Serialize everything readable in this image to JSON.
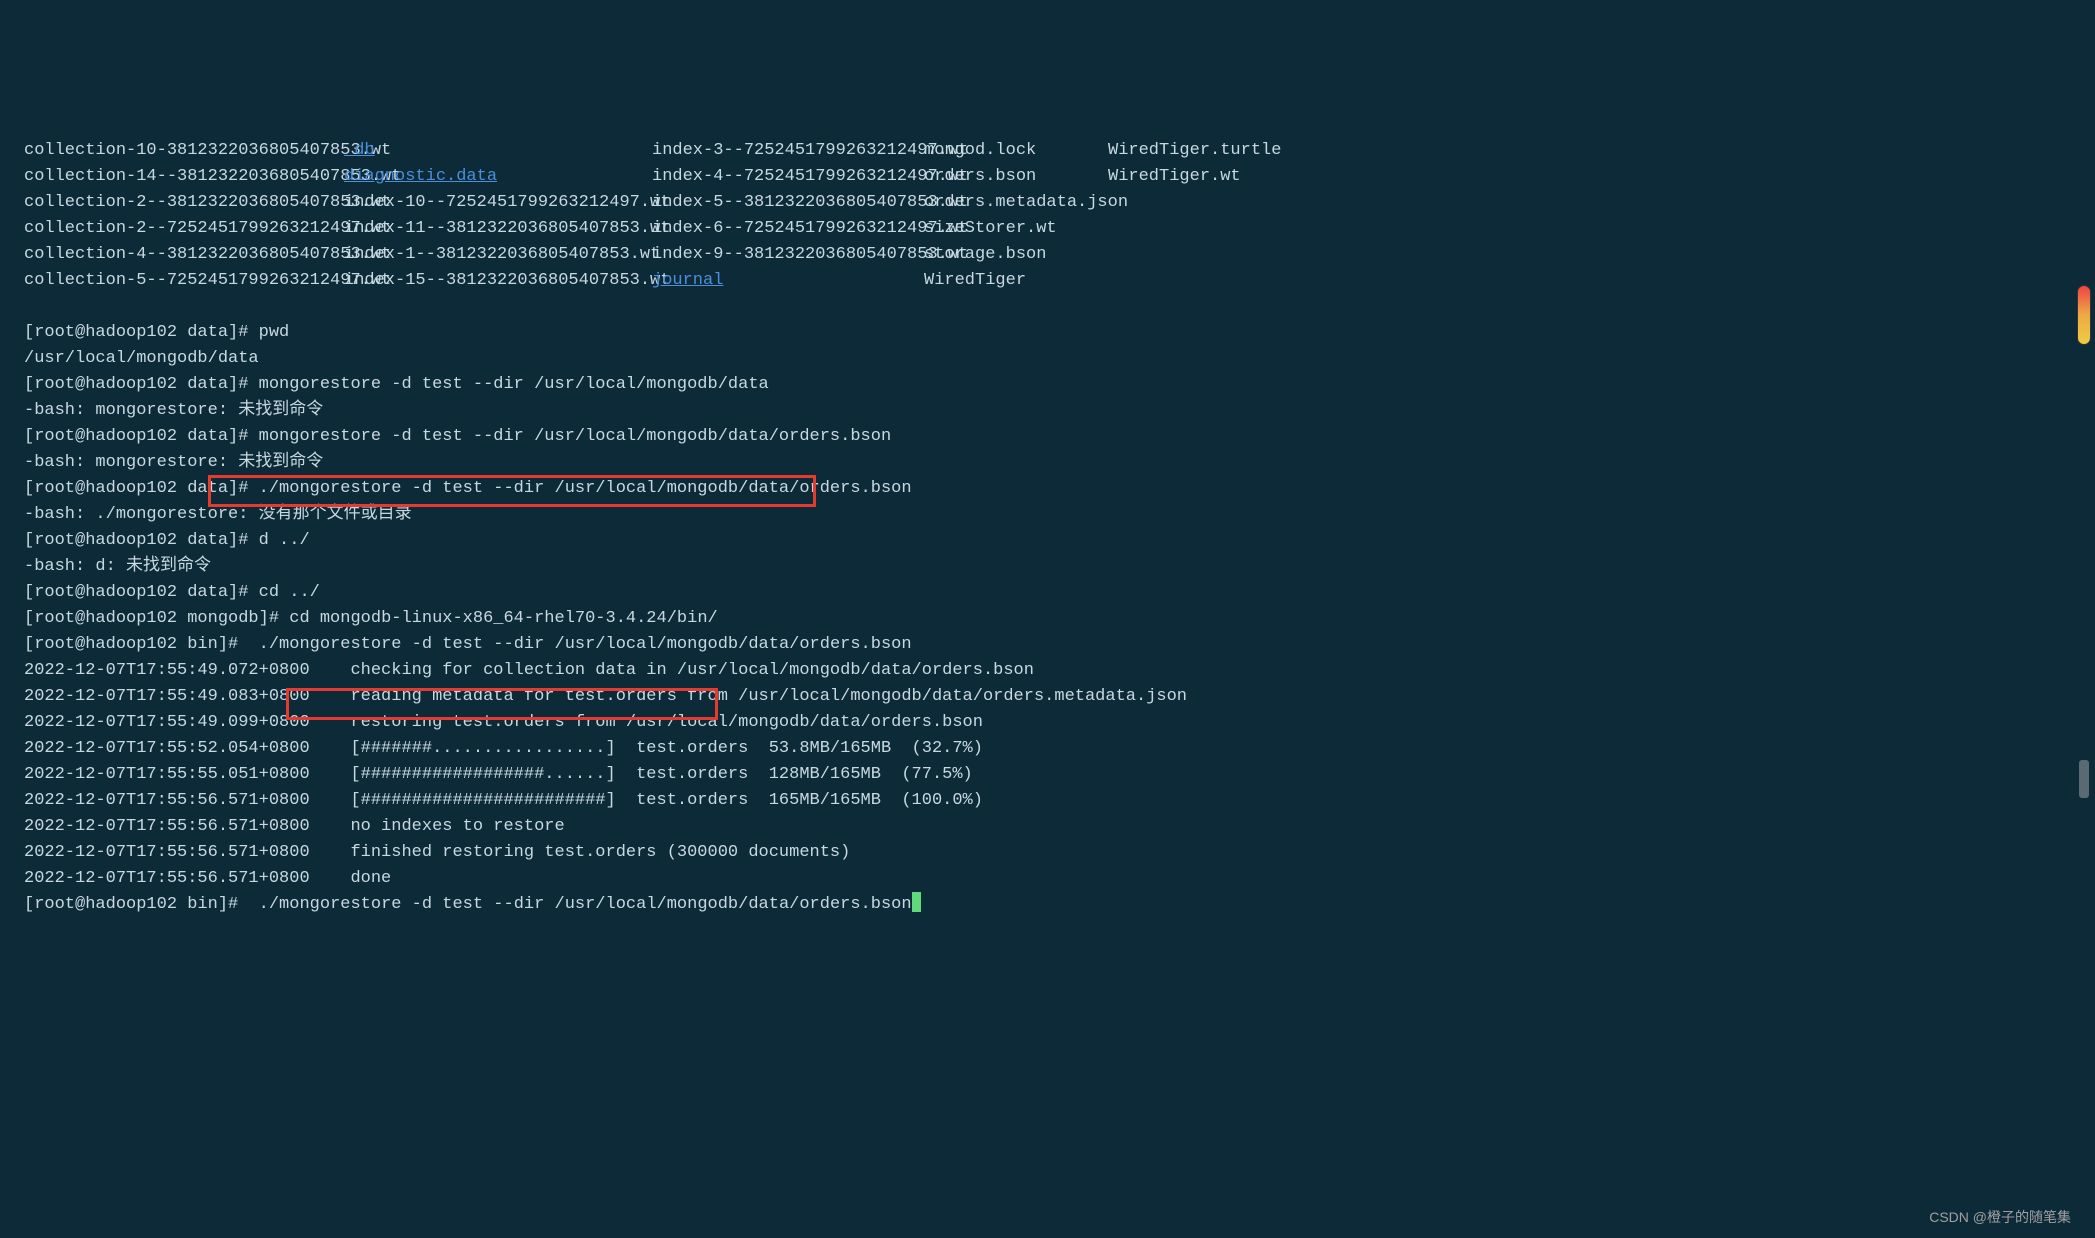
{
  "listing": {
    "col1": [
      "collection-10-3812322036805407853.wt",
      "collection-14--3812322036805407853.wt",
      "collection-2--3812322036805407853.wt",
      "collection-2--7252451799263212497.wt",
      "collection-4--3812322036805407853.wt",
      "collection-5--7252451799263212497.wt"
    ],
    "col2_dir": [
      "_db",
      "diagnostic.data"
    ],
    "col2_rest": [
      "index-10--7252451799263212497.wt",
      "index-11--3812322036805407853.wt",
      "index-1--3812322036805407853.wt",
      "index-15--3812322036805407853.wt"
    ],
    "col3": [
      "index-3--7252451799263212497.wt",
      "index-4--7252451799263212497.wt",
      "index-5--3812322036805407853.wt",
      "index-6--7252451799263212497.wt",
      "index-9--3812322036805407853.wt"
    ],
    "col3_dir": "journal",
    "col4": [
      "mongod.lock",
      "orders.bson",
      "orders.metadata.json",
      "sizeStorer.wt",
      "storage.bson",
      "WiredTiger"
    ],
    "col5": [
      "WiredTiger.turtle",
      "WiredTiger.wt"
    ]
  },
  "lines": [
    {
      "prompt": "[root@hadoop102 data]#",
      "cmd": " pwd"
    },
    {
      "text": "/usr/local/mongodb/data"
    },
    {
      "prompt": "[root@hadoop102 data]#",
      "cmd": " mongorestore -d test --dir /usr/local/mongodb/data"
    },
    {
      "text": "-bash: mongorestore: 未找到命令"
    },
    {
      "prompt": "[root@hadoop102 data]#",
      "cmd": " mongorestore -d test --dir /usr/local/mongodb/data/orders.bson"
    },
    {
      "text": "-bash: mongorestore: 未找到命令"
    },
    {
      "prompt": "[root@hadoop102 data]#",
      "cmd": " ./mongorestore -d test --dir /usr/local/mongodb/data/orders.bson"
    },
    {
      "text": "-bash: ./mongorestore: 没有那个文件或目录"
    },
    {
      "prompt": "[root@hadoop102 data]#",
      "cmd": " d ../"
    },
    {
      "text": "-bash: d: 未找到命令"
    },
    {
      "prompt": "[root@hadoop102 data]#",
      "cmd": " cd ../"
    },
    {
      "prompt": "[root@hadoop102 mongodb]#",
      "cmd": " cd mongodb-linux-x86_64-rhel70-3.4.24/bin/"
    },
    {
      "prompt": "[root@hadoop102 bin]#",
      "cmd": "  ./mongorestore -d test --dir /usr/local/mongodb/data/orders.bson"
    },
    {
      "text": "2022-12-07T17:55:49.072+0800    checking for collection data in /usr/local/mongodb/data/orders.bson"
    },
    {
      "text": "2022-12-07T17:55:49.083+0800    reading metadata for test.orders from /usr/local/mongodb/data/orders.metadata.json"
    },
    {
      "text": "2022-12-07T17:55:49.099+0800    restoring test.orders from /usr/local/mongodb/data/orders.bson"
    },
    {
      "text": "2022-12-07T17:55:52.054+0800    [#######.................]  test.orders  53.8MB/165MB  (32.7%)"
    },
    {
      "text": "2022-12-07T17:55:55.051+0800    [##################......]  test.orders  128MB/165MB  (77.5%)"
    },
    {
      "text": "2022-12-07T17:55:56.571+0800    [########################]  test.orders  165MB/165MB  (100.0%)"
    },
    {
      "text": "2022-12-07T17:55:56.571+0800    no indexes to restore"
    },
    {
      "text": "2022-12-07T17:55:56.571+0800    finished restoring test.orders (300000 documents)"
    },
    {
      "text": "2022-12-07T17:55:56.571+0800    done"
    },
    {
      "prompt": "[root@hadoop102 bin]#",
      "cmd": "  ./mongorestore -d test --dir /usr/local/mongodb/data/orders.bson",
      "cursor": true
    }
  ],
  "watermark": "CSDN @橙子的随笔集"
}
